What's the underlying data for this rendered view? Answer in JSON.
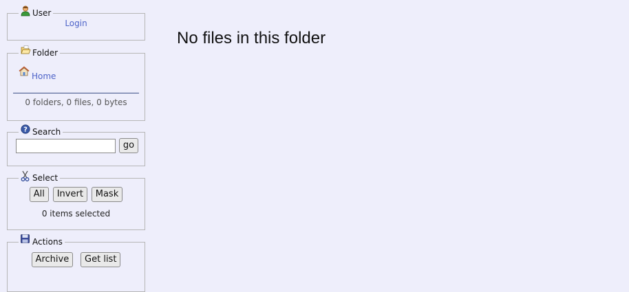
{
  "user": {
    "legend": "User",
    "login_label": "Login"
  },
  "folder": {
    "legend": "Folder",
    "home_label": "Home",
    "summary": "0 folders, 0 files, 0 bytes"
  },
  "search": {
    "legend": "Search",
    "input_value": "",
    "go_label": "go"
  },
  "select": {
    "legend": "Select",
    "buttons": [
      "All",
      "Invert",
      "Mask"
    ],
    "status": "0 items selected"
  },
  "actions": {
    "legend": "Actions",
    "buttons": [
      "Archive",
      "Get list"
    ]
  },
  "main": {
    "message": "No files in this folder"
  },
  "icons": {
    "user": "user-icon",
    "folder": "folder-open-icon",
    "home": "home-icon",
    "search": "help-icon",
    "select": "scissors-icon",
    "actions": "floppy-disk-icon"
  },
  "colors": {
    "background": "#eeeefb",
    "link": "#4d63c8",
    "border": "#b6b6b6"
  }
}
